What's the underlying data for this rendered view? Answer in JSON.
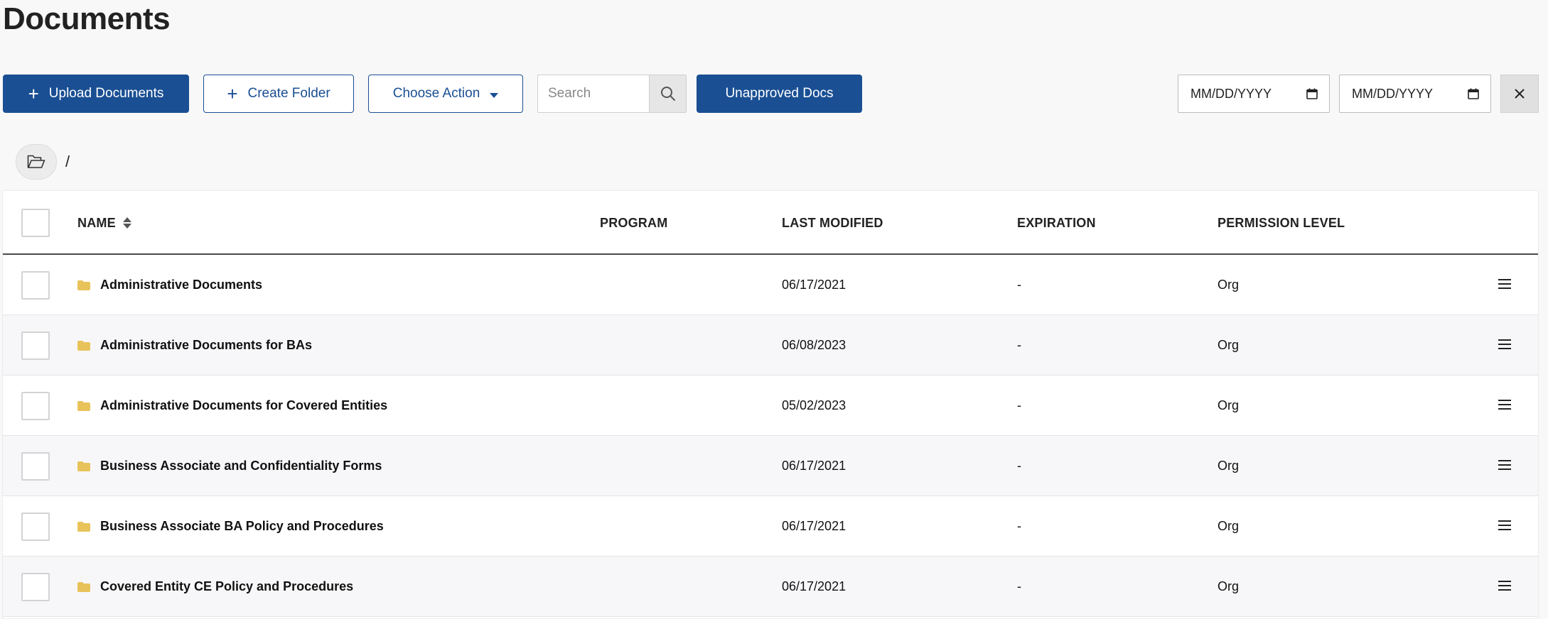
{
  "page": {
    "title": "Documents"
  },
  "toolbar": {
    "upload_label": "Upload Documents",
    "create_folder_label": "Create Folder",
    "choose_action_label": "Choose Action",
    "search_placeholder": "Search",
    "unapproved_label": "Unapproved Docs",
    "date_from_placeholder": "MM/DD/YYYY",
    "date_to_placeholder": "MM/DD/YYYY"
  },
  "breadcrumb": {
    "separator": "/"
  },
  "table": {
    "columns": {
      "name": "NAME",
      "program": "PROGRAM",
      "last_modified": "LAST MODIFIED",
      "expiration": "EXPIRATION",
      "permission": "PERMISSION LEVEL"
    },
    "rows": [
      {
        "name": "Administrative Documents",
        "program": "",
        "last_modified": "06/17/2021",
        "expiration": "-",
        "permission": "Org"
      },
      {
        "name": "Administrative Documents for BAs",
        "program": "",
        "last_modified": "06/08/2023",
        "expiration": "-",
        "permission": "Org"
      },
      {
        "name": "Administrative Documents for Covered Entities",
        "program": "",
        "last_modified": "05/02/2023",
        "expiration": "-",
        "permission": "Org"
      },
      {
        "name": "Business Associate and Confidentiality Forms",
        "program": "",
        "last_modified": "06/17/2021",
        "expiration": "-",
        "permission": "Org"
      },
      {
        "name": "Business Associate BA Policy and Procedures",
        "program": "",
        "last_modified": "06/17/2021",
        "expiration": "-",
        "permission": "Org"
      },
      {
        "name": "Covered Entity CE Policy and Procedures",
        "program": "",
        "last_modified": "06/17/2021",
        "expiration": "-",
        "permission": "Org"
      }
    ]
  },
  "colors": {
    "primary": "#1a4f93",
    "folder": "#e8c35a",
    "background": "#f8f8f8"
  },
  "icons": {
    "upload": "plus-icon",
    "create_folder": "plus-icon",
    "choose_action": "caret-down-icon",
    "search": "search-icon",
    "date": "calendar-icon",
    "clear": "close-icon",
    "breadcrumb_root": "open-folder-icon",
    "sort": "sort-icon",
    "row_folder": "folder-icon",
    "row_menu": "menu-icon"
  }
}
